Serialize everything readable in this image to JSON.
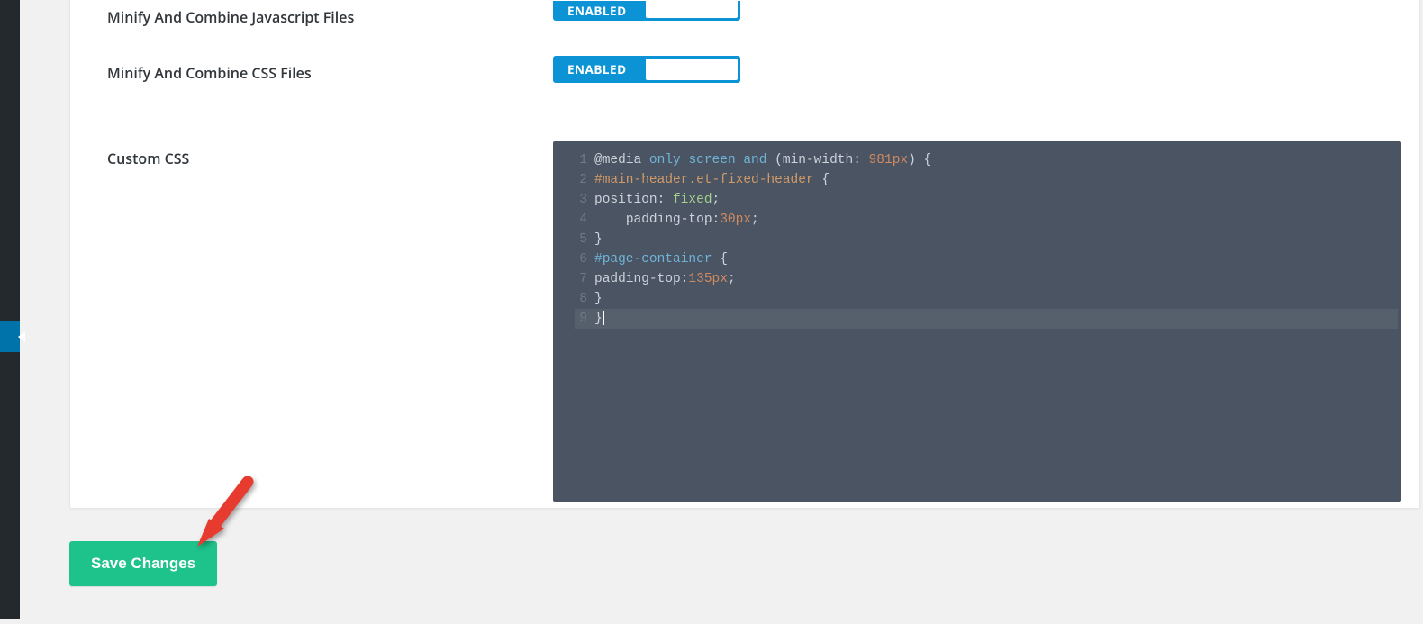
{
  "settings": {
    "minify_js": {
      "label": "Minify And Combine Javascript Files",
      "toggle_label": "ENABLED"
    },
    "minify_css": {
      "label": "Minify And Combine CSS Files",
      "toggle_label": "ENABLED"
    },
    "custom_css": {
      "label": "Custom CSS"
    }
  },
  "editor": {
    "lines": [
      "@media only screen and (min-width: 981px) {",
      "#main-header.et-fixed-header {",
      "position: fixed;",
      "    padding-top:30px;",
      "}",
      "#page-container {",
      "padding-top:135px;",
      "}",
      "}"
    ],
    "line_numbers": [
      "1",
      "2",
      "3",
      "4",
      "5",
      "6",
      "7",
      "8",
      "9"
    ],
    "active_line": 9
  },
  "buttons": {
    "save": "Save Changes"
  }
}
